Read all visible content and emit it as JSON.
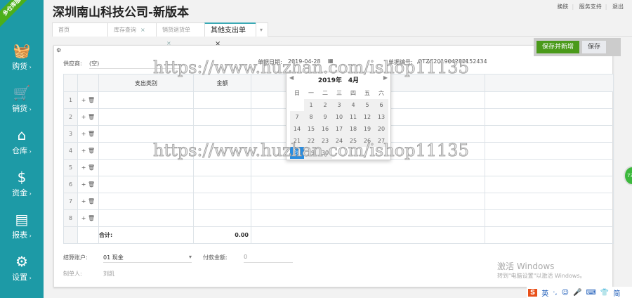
{
  "ribbon": "多仓库版",
  "title": "深圳南山科技公司-新版本",
  "top_links": [
    "换肤",
    "服务支持",
    "退出"
  ],
  "sidebar": [
    {
      "label": "购货",
      "icon": "basket-icon"
    },
    {
      "label": "销货",
      "icon": "cart-icon"
    },
    {
      "label": "仓库",
      "icon": "warehouse-icon"
    },
    {
      "label": "资金",
      "icon": "dollar-icon"
    },
    {
      "label": "报表",
      "icon": "report-icon"
    },
    {
      "label": "设置",
      "icon": "gear-icon"
    }
  ],
  "tabs": [
    {
      "label": "首页"
    },
    {
      "label": "库存查询"
    },
    {
      "label": "销货退货单"
    },
    {
      "label": "其他支出单"
    }
  ],
  "buttons": {
    "save_new": "保存并新增",
    "save": "保存"
  },
  "form": {
    "supplier_label": "供应商:",
    "supplier_value": "(空)",
    "date_label": "单据日期:",
    "date_value": "2019-04-28",
    "number_label": "单据编号:",
    "number_value": "QTZC201904282152434",
    "account_label": "结算账户:",
    "account_value": "01 现金",
    "pay_label": "付款金额:",
    "pay_value": "0",
    "maker_label": "制单人:",
    "maker_value": "刘凯"
  },
  "table": {
    "headers": [
      "支出类别",
      "金额"
    ],
    "rows": [
      "1",
      "2",
      "3",
      "4",
      "5",
      "6",
      "7",
      "8"
    ],
    "total_label": "合计:",
    "total_value": "0.00"
  },
  "calendar": {
    "title": "2019年　4月",
    "weekdays": [
      "日",
      "一",
      "二",
      "三",
      "四",
      "五",
      "六"
    ],
    "days": [
      "",
      "1",
      "2",
      "3",
      "4",
      "5",
      "6",
      "7",
      "8",
      "9",
      "10",
      "11",
      "12",
      "13",
      "14",
      "15",
      "16",
      "17",
      "18",
      "19",
      "20",
      "21",
      "22",
      "23",
      "24",
      "25",
      "26",
      "27",
      "28",
      "29",
      "30"
    ],
    "selected": "28"
  },
  "watermark": "https://www.huzhan.com/ishop11135",
  "activation": {
    "title": "激活 Windows",
    "sub": "转到\"电脑设置\"以激活 Windows。"
  },
  "tray": [
    "S",
    "英",
    "·,",
    "☺",
    "🎤",
    "⌨",
    "👕",
    "简"
  ],
  "badge": "73"
}
